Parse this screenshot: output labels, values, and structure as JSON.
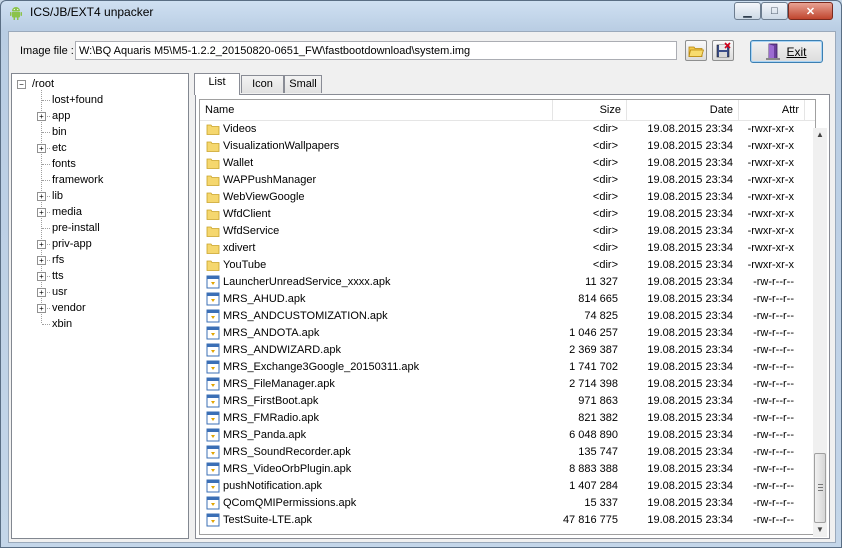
{
  "window": {
    "title": "ICS/JB/EXT4 unpacker"
  },
  "toolbar": {
    "image_label": "Image file :",
    "image_path": "W:\\BQ Aquaris M5\\M5-1.2.2_20150820-0651_FW\\fastbootdownload\\system.img",
    "exit_label": "Exit"
  },
  "tree": {
    "root": "/root",
    "items": [
      "lost+found",
      "app",
      "bin",
      "etc",
      "fonts",
      "framework",
      "lib",
      "media",
      "pre-install",
      "priv-app",
      "rfs",
      "tts",
      "usr",
      "vendor",
      "xbin"
    ],
    "expandable": [
      false,
      true,
      false,
      true,
      false,
      false,
      true,
      true,
      false,
      true,
      true,
      true,
      true,
      true,
      false
    ]
  },
  "tabs": [
    "List",
    "Icon",
    "Small"
  ],
  "list": {
    "columns": {
      "name": "Name",
      "size": "Size",
      "date": "Date",
      "attr": "Attr"
    },
    "rows": [
      {
        "icon": "folder",
        "name": "Videos",
        "size": "<dir>",
        "date": "19.08.2015 23:34",
        "attr": "-rwxr-xr-x"
      },
      {
        "icon": "folder",
        "name": "VisualizationWallpapers",
        "size": "<dir>",
        "date": "19.08.2015 23:34",
        "attr": "-rwxr-xr-x"
      },
      {
        "icon": "folder",
        "name": "Wallet",
        "size": "<dir>",
        "date": "19.08.2015 23:34",
        "attr": "-rwxr-xr-x"
      },
      {
        "icon": "folder",
        "name": "WAPPushManager",
        "size": "<dir>",
        "date": "19.08.2015 23:34",
        "attr": "-rwxr-xr-x"
      },
      {
        "icon": "folder",
        "name": "WebViewGoogle",
        "size": "<dir>",
        "date": "19.08.2015 23:34",
        "attr": "-rwxr-xr-x"
      },
      {
        "icon": "folder",
        "name": "WfdClient",
        "size": "<dir>",
        "date": "19.08.2015 23:34",
        "attr": "-rwxr-xr-x"
      },
      {
        "icon": "folder",
        "name": "WfdService",
        "size": "<dir>",
        "date": "19.08.2015 23:34",
        "attr": "-rwxr-xr-x"
      },
      {
        "icon": "folder",
        "name": "xdivert",
        "size": "<dir>",
        "date": "19.08.2015 23:34",
        "attr": "-rwxr-xr-x"
      },
      {
        "icon": "folder",
        "name": "YouTube",
        "size": "<dir>",
        "date": "19.08.2015 23:34",
        "attr": "-rwxr-xr-x"
      },
      {
        "icon": "file",
        "name": "LauncherUnreadService_xxxx.apk",
        "size": "11 327",
        "date": "19.08.2015 23:34",
        "attr": "-rw-r--r--"
      },
      {
        "icon": "file",
        "name": "MRS_AHUD.apk",
        "size": "814 665",
        "date": "19.08.2015 23:34",
        "attr": "-rw-r--r--"
      },
      {
        "icon": "file",
        "name": "MRS_ANDCUSTOMIZATION.apk",
        "size": "74 825",
        "date": "19.08.2015 23:34",
        "attr": "-rw-r--r--"
      },
      {
        "icon": "file",
        "name": "MRS_ANDOTA.apk",
        "size": "1 046 257",
        "date": "19.08.2015 23:34",
        "attr": "-rw-r--r--"
      },
      {
        "icon": "file",
        "name": "MRS_ANDWIZARD.apk",
        "size": "2 369 387",
        "date": "19.08.2015 23:34",
        "attr": "-rw-r--r--"
      },
      {
        "icon": "file",
        "name": "MRS_Exchange3Google_20150311.apk",
        "size": "1 741 702",
        "date": "19.08.2015 23:34",
        "attr": "-rw-r--r--"
      },
      {
        "icon": "file",
        "name": "MRS_FileManager.apk",
        "size": "2 714 398",
        "date": "19.08.2015 23:34",
        "attr": "-rw-r--r--"
      },
      {
        "icon": "file",
        "name": "MRS_FirstBoot.apk",
        "size": "971 863",
        "date": "19.08.2015 23:34",
        "attr": "-rw-r--r--"
      },
      {
        "icon": "file",
        "name": "MRS_FMRadio.apk",
        "size": "821 382",
        "date": "19.08.2015 23:34",
        "attr": "-rw-r--r--"
      },
      {
        "icon": "file",
        "name": "MRS_Panda.apk",
        "size": "6 048 890",
        "date": "19.08.2015 23:34",
        "attr": "-rw-r--r--"
      },
      {
        "icon": "file",
        "name": "MRS_SoundRecorder.apk",
        "size": "135 747",
        "date": "19.08.2015 23:34",
        "attr": "-rw-r--r--"
      },
      {
        "icon": "file",
        "name": "MRS_VideoOrbPlugin.apk",
        "size": "8 883 388",
        "date": "19.08.2015 23:34",
        "attr": "-rw-r--r--"
      },
      {
        "icon": "file",
        "name": "pushNotification.apk",
        "size": "1 407 284",
        "date": "19.08.2015 23:34",
        "attr": "-rw-r--r--"
      },
      {
        "icon": "file",
        "name": "QComQMIPermissions.apk",
        "size": "15 337",
        "date": "19.08.2015 23:34",
        "attr": "-rw-r--r--"
      },
      {
        "icon": "file",
        "name": "TestSuite-LTE.apk",
        "size": "47 816 775",
        "date": "19.08.2015 23:34",
        "attr": "-rw-r--r--"
      }
    ]
  }
}
